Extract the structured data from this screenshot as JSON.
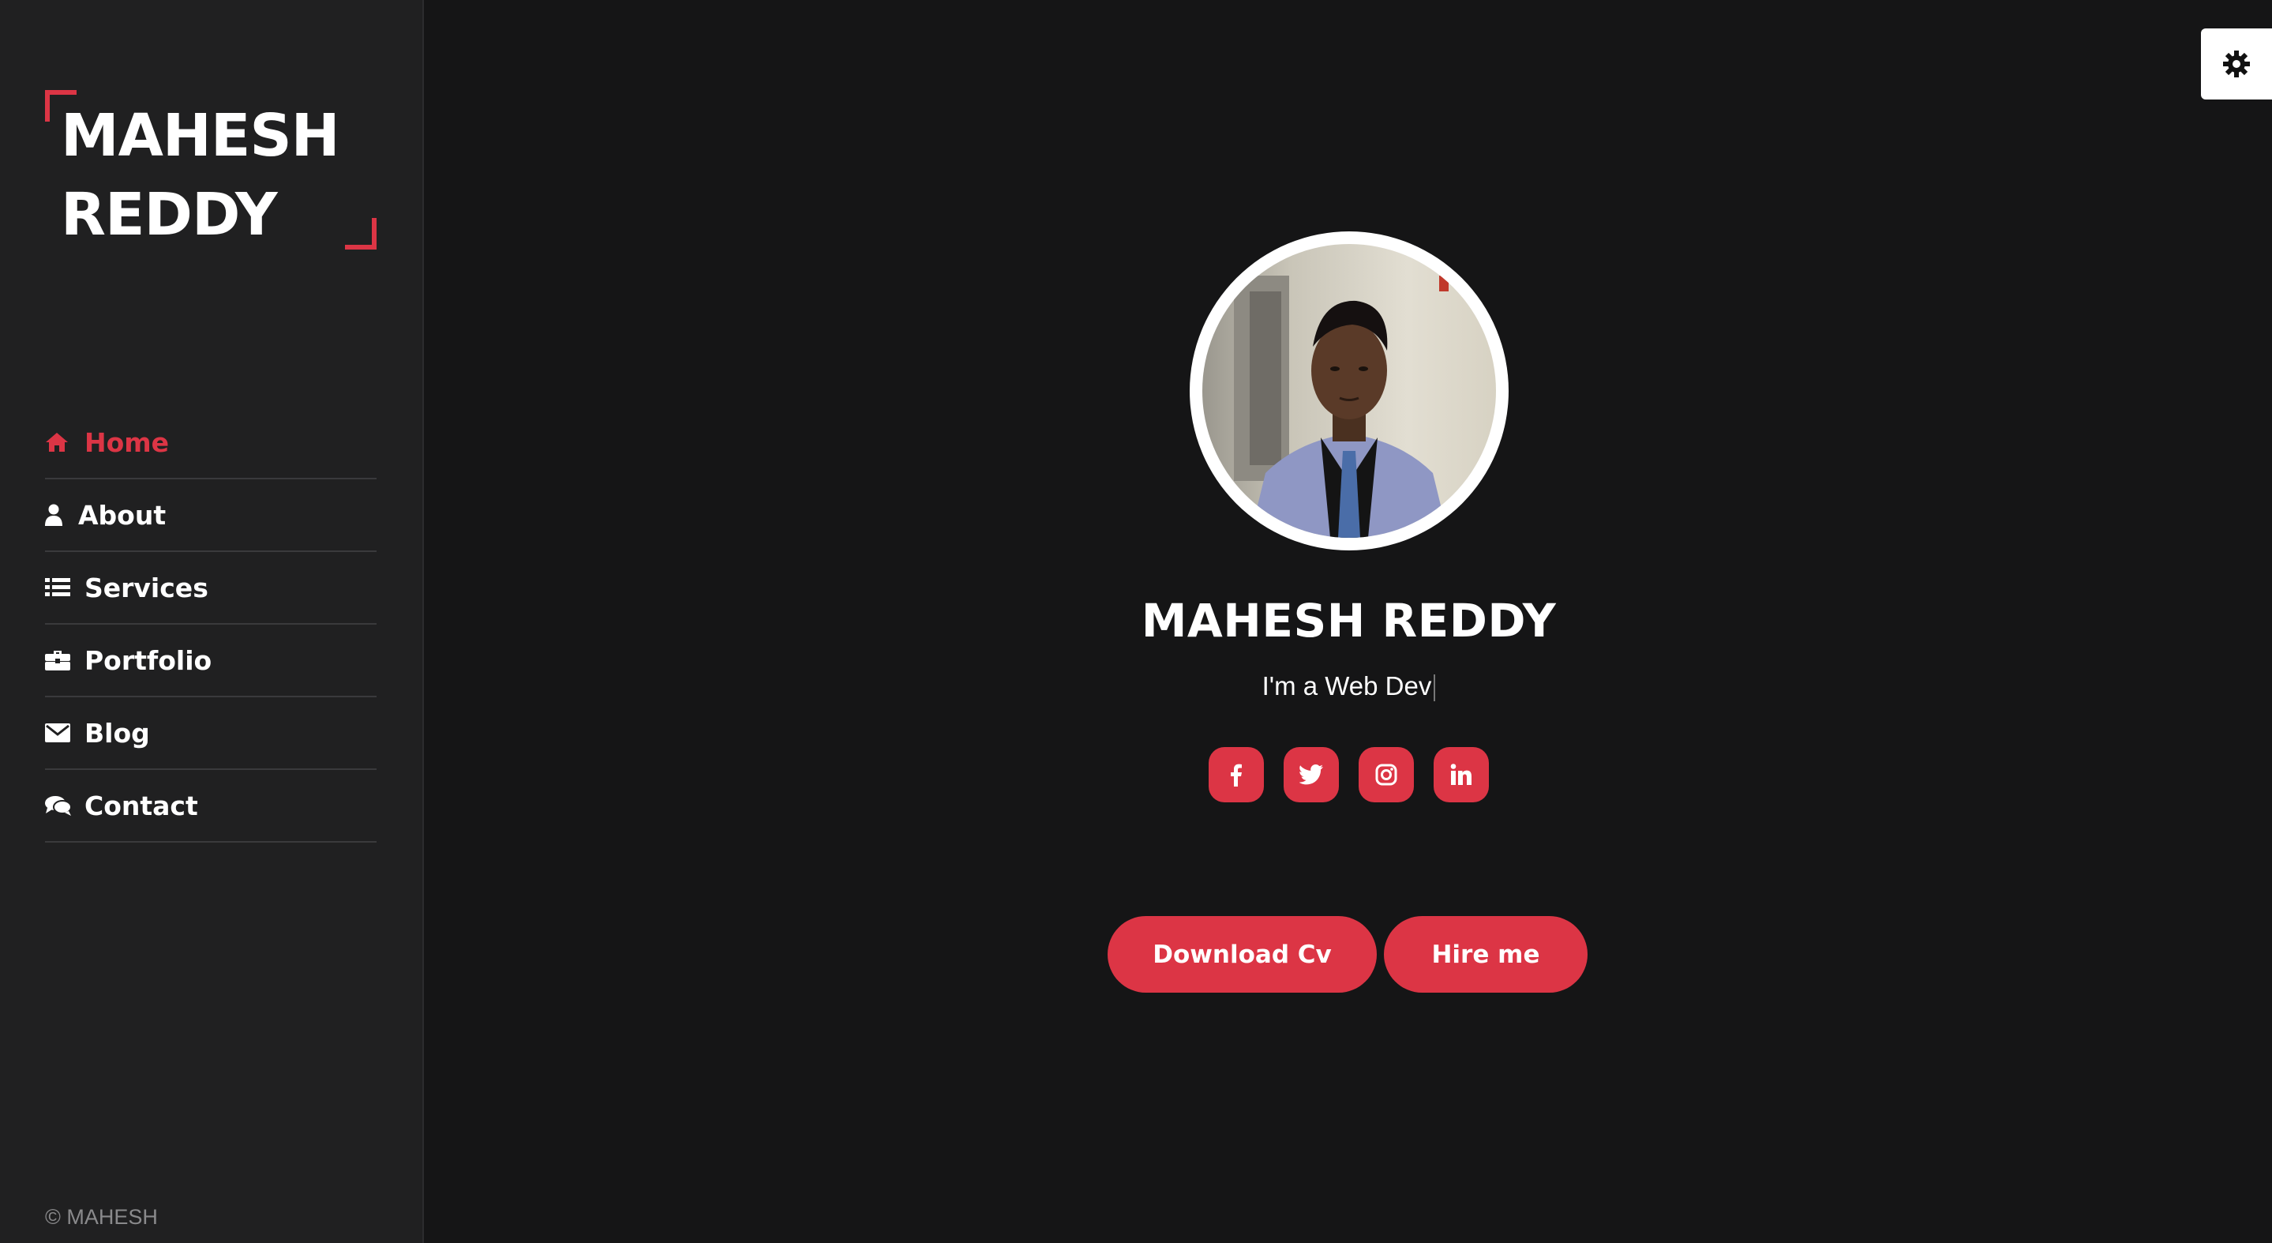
{
  "brand": {
    "line1": "MAHESH",
    "line2": "REDDY"
  },
  "nav": {
    "items": [
      {
        "label": "Home",
        "icon": "home-icon",
        "active": true
      },
      {
        "label": "About",
        "icon": "user-icon",
        "active": false
      },
      {
        "label": "Services",
        "icon": "list-icon",
        "active": false
      },
      {
        "label": "Portfolio",
        "icon": "briefcase-icon",
        "active": false
      },
      {
        "label": "Blog",
        "icon": "envelope-icon",
        "active": false
      },
      {
        "label": "Contact",
        "icon": "comments-icon",
        "active": false
      }
    ]
  },
  "footer": {
    "copyright": "© MAHESH"
  },
  "hero": {
    "name": "MAHESH REDDY",
    "tagline": "I'm a Web Dev",
    "socials": [
      {
        "name": "facebook-icon"
      },
      {
        "name": "twitter-icon"
      },
      {
        "name": "instagram-icon"
      },
      {
        "name": "linkedin-icon"
      }
    ],
    "download_cv_label": "Download Cv",
    "hire_me_label": "Hire me"
  },
  "colors": {
    "accent": "#dc3545",
    "sidebar_bg": "#202021",
    "page_bg": "#151516"
  },
  "settings": {
    "icon": "gear-icon"
  }
}
